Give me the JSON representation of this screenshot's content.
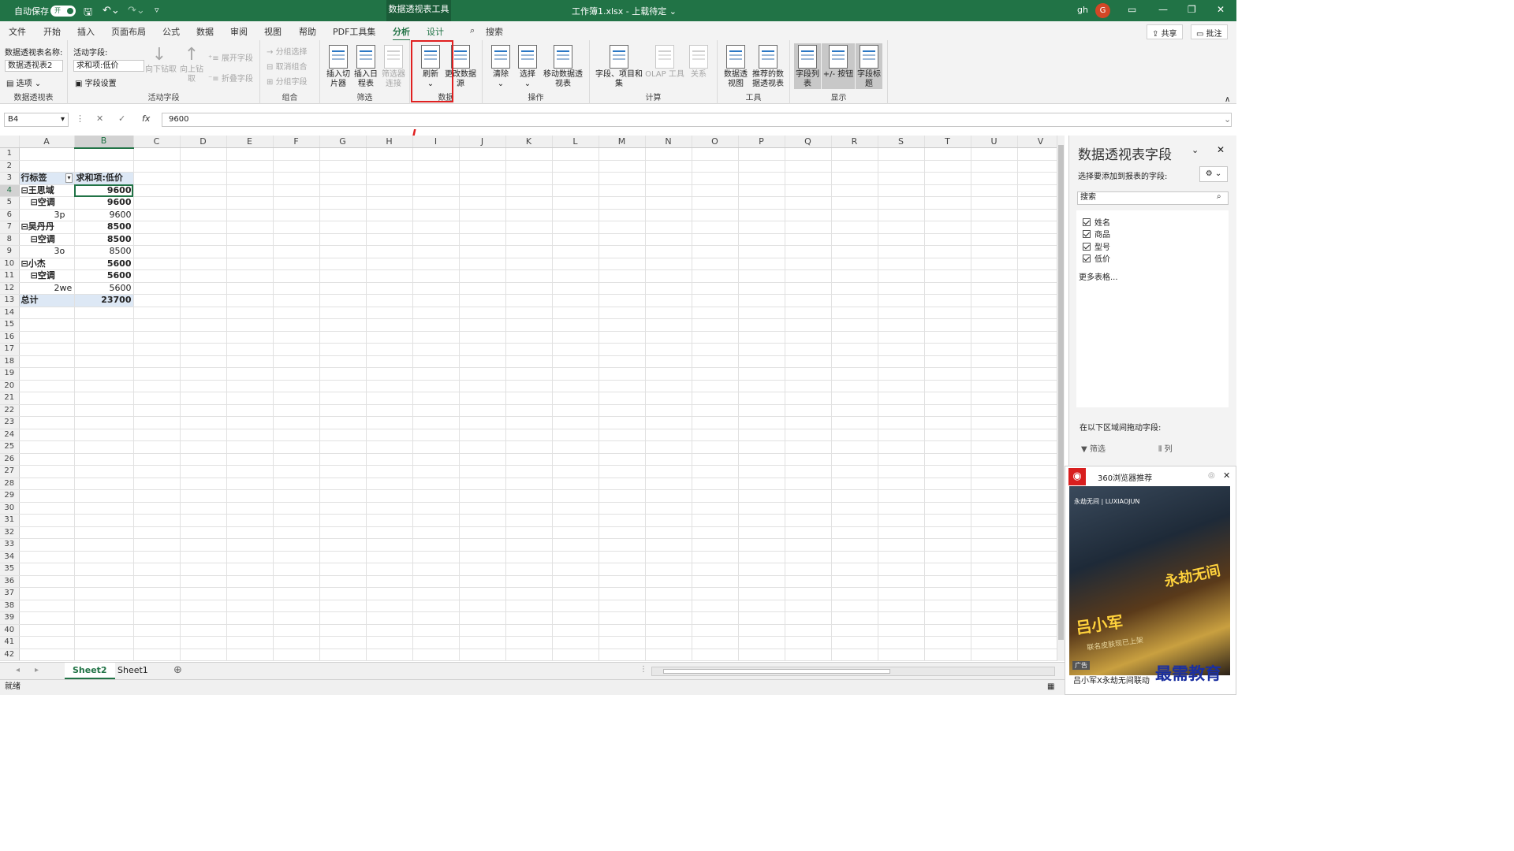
{
  "titlebar": {
    "autosave_label": "自动保存",
    "autosave_state": "开",
    "context_tab": "数据透视表工具",
    "doc_title": "工作簿1.xlsx - 上载待定 ⌄",
    "user": "gh",
    "avatar_letter": "G"
  },
  "menu": {
    "items": [
      "文件",
      "开始",
      "插入",
      "页面布局",
      "公式",
      "数据",
      "审阅",
      "视图",
      "帮助",
      "PDF工具集",
      "分析",
      "设计"
    ],
    "active": "分析",
    "search": "搜索",
    "share": "共享",
    "comment": "批注"
  },
  "ribbon": {
    "pivot_name_label": "数据透视表名称:",
    "pivot_name_value": "数据透视表2",
    "options": "选项",
    "group_pivot": "数据透视表",
    "active_field_label": "活动字段:",
    "active_field_value": "求和项:低价",
    "field_settings": "字段设置",
    "drill_down": "向下钻取",
    "drill_up": "向上钻取",
    "expand_field": "展开字段",
    "collapse_field": "折叠字段",
    "group_active_field": "活动字段",
    "group_selection": "分组选择",
    "ungroup": "取消组合",
    "group_field": "分组字段",
    "group_group": "组合",
    "insert_slicer": "插入切片器",
    "insert_timeline": "插入日程表",
    "filter_connections": "筛选器连接",
    "group_filter": "筛选",
    "refresh": "刷新",
    "change_source": "更改数据源",
    "group_data": "数据",
    "clear": "清除",
    "select": "选择",
    "move_pivot": "移动数据透视表",
    "group_actions": "操作",
    "fields_items": "字段、项目和集",
    "olap": "OLAP 工具",
    "relations": "关系",
    "group_calc": "计算",
    "pivot_chart": "数据透视图",
    "recommended": "推荐的数据透视表",
    "group_tools": "工具",
    "field_list": "字段列表",
    "plus_minus": "+/- 按钮",
    "field_headers": "字段标题",
    "group_show": "显示"
  },
  "formula_bar": {
    "name_box": "B4",
    "value": "9600"
  },
  "grid": {
    "columns": [
      "A",
      "B",
      "C",
      "D",
      "E",
      "F",
      "G",
      "H",
      "I",
      "J",
      "K",
      "L",
      "M",
      "N",
      "O",
      "P",
      "Q",
      "R",
      "S",
      "T",
      "U",
      "V"
    ],
    "row_count": 42,
    "pivot_header": [
      "行标签",
      "求和项:低价"
    ],
    "pivot_rows": [
      {
        "label": "⊟王思域",
        "value": "9600",
        "level": 0
      },
      {
        "label": "⊟空调",
        "value": "9600",
        "level": 1
      },
      {
        "label": "3p",
        "value": "9600",
        "level": 2
      },
      {
        "label": "⊟吴丹丹",
        "value": "8500",
        "level": 0
      },
      {
        "label": "⊟空调",
        "value": "8500",
        "level": 1
      },
      {
        "label": "3o",
        "value": "8500",
        "level": 2
      },
      {
        "label": "⊟小杰",
        "value": "5600",
        "level": 0
      },
      {
        "label": "⊟空调",
        "value": "5600",
        "level": 1
      },
      {
        "label": "2we",
        "value": "5600",
        "level": 2
      }
    ],
    "total_label": "总计",
    "total_value": "23700"
  },
  "sheet_tabs": [
    "Sheet2",
    "Sheet1"
  ],
  "active_sheet": "Sheet2",
  "status": "就绪",
  "field_pane": {
    "title": "数据透视表字段",
    "subtitle": "选择要添加到报表的字段:",
    "search_placeholder": "搜索",
    "fields": [
      "姓名",
      "商品",
      "型号",
      "低价"
    ],
    "more_tables": "更多表格...",
    "drag_label": "在以下区域间拖动字段:",
    "area_filter": "筛选",
    "area_columns": "列"
  },
  "ad": {
    "source": "360浏览器推荐",
    "badge": "广告",
    "caption": "吕小军X永劫无间联动",
    "logo_text": "永劫无间 | LUXIAOJUN",
    "art_name": "吕小军",
    "art_game": "永劫无间",
    "art_sub": "联名皮肤现已上架"
  },
  "watermark": "最需教育",
  "colors": {
    "accent": "#217346",
    "highlight": "#e02020"
  }
}
